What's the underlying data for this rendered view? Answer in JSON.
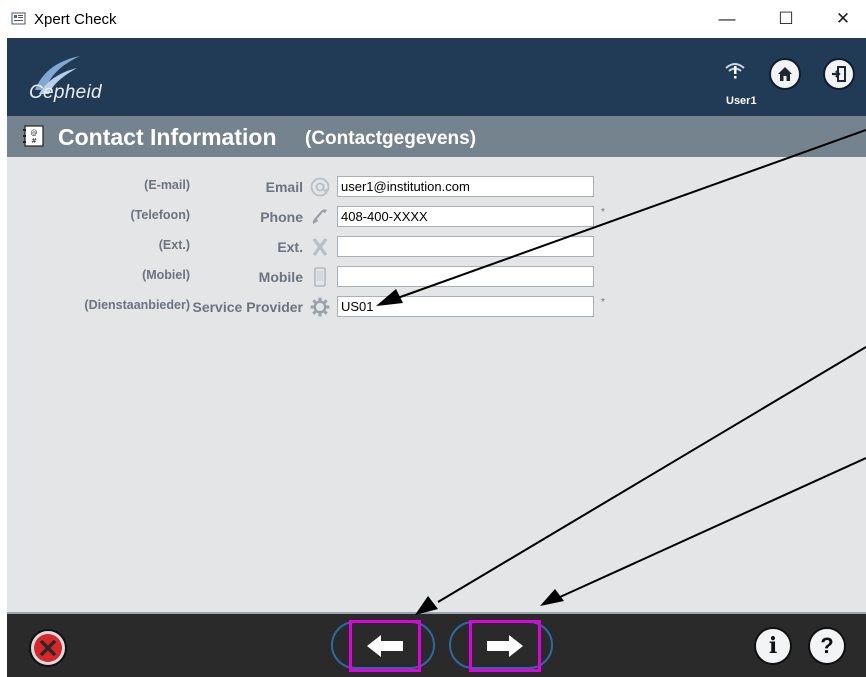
{
  "window": {
    "title": "Xpert Check",
    "minimize_glyph": "—",
    "maximize_glyph": "☐",
    "close_glyph": "✕"
  },
  "header": {
    "logo_text": "Cepheid",
    "user_label": "User1",
    "icons": [
      "user-warning-icon",
      "home-icon",
      "exit-icon"
    ]
  },
  "section": {
    "title": "Contact Information",
    "subtitle": "(Contactgegevens)",
    "icon": "contact-card-icon"
  },
  "form": {
    "fields": [
      {
        "dutch": "(E-mail)",
        "label": "Email",
        "icon": "at-icon",
        "value": "user1@institution.com",
        "required": ""
      },
      {
        "dutch": "(Telefoon)",
        "label": "Phone",
        "icon": "phone-icon",
        "value": "408-400-XXXX",
        "required": "*"
      },
      {
        "dutch": "(Ext.)",
        "label": "Ext.",
        "icon": "x-icon",
        "value": "",
        "required": ""
      },
      {
        "dutch": "(Mobiel)",
        "label": "Mobile",
        "icon": "mobile-icon",
        "value": "",
        "required": ""
      },
      {
        "dutch": "(Dienstaanbieder)",
        "label": "Service Provider",
        "icon": "gear-icon",
        "value": "US01",
        "required": "*"
      }
    ]
  },
  "footer": {
    "buttons": [
      "cancel-icon",
      "arrow-left-icon",
      "arrow-right-icon",
      "info-icon",
      "help-icon"
    ],
    "info_glyph": "i",
    "help_glyph": "?"
  },
  "colors": {
    "header": "#213a55",
    "section": "#75838f",
    "content": "#e3e5e7",
    "footer": "#2a2a2a",
    "highlight": "#e000e0",
    "cancel_red": "#d8262a"
  }
}
